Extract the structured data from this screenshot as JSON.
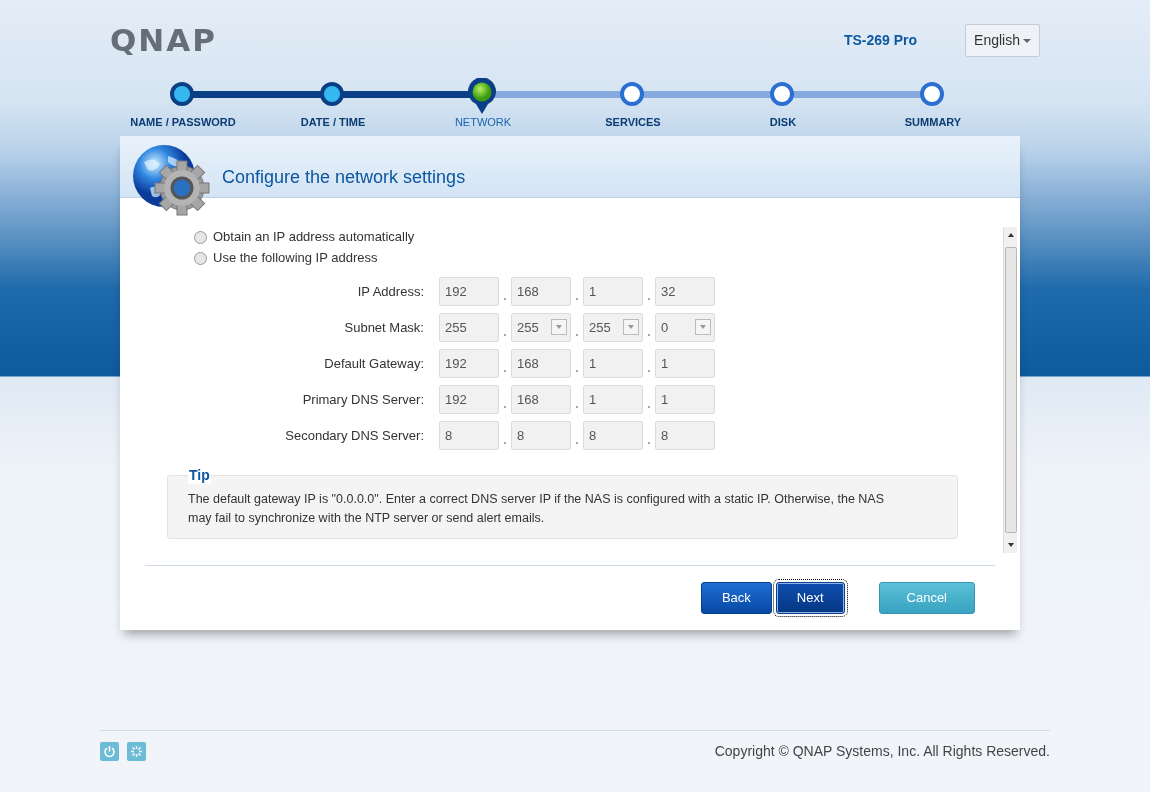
{
  "header": {
    "logo": "QNAP",
    "model": "TS-269 Pro",
    "language": "English"
  },
  "steps": [
    {
      "label": "NAME / PASSWORD",
      "done": true,
      "selected": false
    },
    {
      "label": "DATE / TIME",
      "done": true,
      "selected": false
    },
    {
      "label": "NETWORK",
      "done": false,
      "selected": true
    },
    {
      "label": "SERVICES",
      "done": false,
      "selected": false
    },
    {
      "label": "DISK",
      "done": false,
      "selected": false
    },
    {
      "label": "SUMMARY",
      "done": false,
      "selected": false
    }
  ],
  "panel": {
    "title": "Configure the network settings",
    "ip_options": [
      {
        "label": "Obtain an IP address automatically",
        "selected": false
      },
      {
        "label": "Use the following IP address",
        "selected": false
      }
    ],
    "fields": [
      {
        "label": "IP Address:",
        "parts": [
          {
            "kind": "text",
            "value": "192"
          },
          {
            "kind": "text",
            "value": "168"
          },
          {
            "kind": "text",
            "value": "1"
          },
          {
            "kind": "text",
            "value": "32"
          }
        ]
      },
      {
        "label": "Subnet Mask:",
        "parts": [
          {
            "kind": "text",
            "value": "255"
          },
          {
            "kind": "select",
            "value": "255"
          },
          {
            "kind": "select",
            "value": "255"
          },
          {
            "kind": "select",
            "value": "0"
          }
        ]
      },
      {
        "label": "Default Gateway:",
        "parts": [
          {
            "kind": "text",
            "value": "192"
          },
          {
            "kind": "text",
            "value": "168"
          },
          {
            "kind": "text",
            "value": "1"
          },
          {
            "kind": "text",
            "value": "1"
          }
        ]
      },
      {
        "label": "Primary DNS Server:",
        "parts": [
          {
            "kind": "text",
            "value": "192"
          },
          {
            "kind": "text",
            "value": "168"
          },
          {
            "kind": "text",
            "value": "1"
          },
          {
            "kind": "text",
            "value": "1"
          }
        ]
      },
      {
        "label": "Secondary DNS Server:",
        "parts": [
          {
            "kind": "text",
            "value": "8"
          },
          {
            "kind": "text",
            "value": "8"
          },
          {
            "kind": "text",
            "value": "8"
          },
          {
            "kind": "text",
            "value": "8"
          }
        ]
      }
    ],
    "tip": {
      "title": "Tip",
      "text": "The default gateway IP is \"0.0.0.0\". Enter a correct DNS server IP if the NAS is configured with a static IP. Otherwise, the NAS may fail to synchronize with the NTP server or send alert emails."
    },
    "buttons": [
      {
        "label": "Back",
        "kind": "primary",
        "focused": false
      },
      {
        "label": "Next",
        "kind": "primary",
        "focused": true
      },
      {
        "label": "Cancel",
        "kind": "secondary",
        "focused": false
      }
    ]
  },
  "footer": {
    "copyright": "Copyright © QNAP Systems, Inc. All Rights Reserved."
  }
}
